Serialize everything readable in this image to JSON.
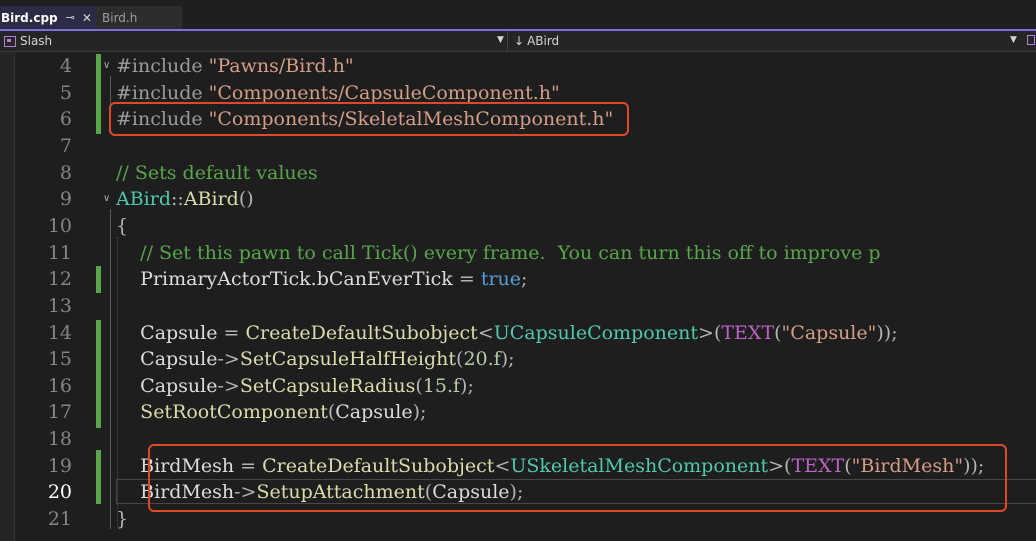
{
  "tabs": [
    {
      "label": "Bird.cpp",
      "pin": "⊸",
      "close": "✕"
    },
    {
      "label": "Bird.h"
    }
  ],
  "navbar": {
    "project": "Slash",
    "member_arrow": "↓",
    "member": "ABird"
  },
  "colors": {
    "accent": "#7c6fd9",
    "highlight": "#e0482a",
    "change_bar": "#57a64a"
  },
  "current_line": 20,
  "lines": [
    {
      "n": 4,
      "tokens": [
        [
          "pp",
          "#include "
        ],
        [
          "str",
          "\"Pawns/Bird.h\""
        ]
      ]
    },
    {
      "n": 5,
      "tokens": [
        [
          "pp",
          "#include "
        ],
        [
          "str",
          "\"Components/CapsuleComponent.h\""
        ]
      ]
    },
    {
      "n": 6,
      "tokens": [
        [
          "pp",
          "#include "
        ],
        [
          "str",
          "\"Components/SkeletalMeshComponent.h\""
        ]
      ]
    },
    {
      "n": 7,
      "tokens": []
    },
    {
      "n": 8,
      "tokens": [
        [
          "com",
          "// Sets default values"
        ]
      ]
    },
    {
      "n": 9,
      "tokens": [
        [
          "type",
          "ABird"
        ],
        [
          "punc",
          "::"
        ],
        [
          "fn",
          "ABird"
        ],
        [
          "punc",
          "()"
        ]
      ]
    },
    {
      "n": 10,
      "tokens": [
        [
          "punc",
          "{"
        ]
      ]
    },
    {
      "n": 11,
      "tokens": [
        [
          "var",
          "    "
        ],
        [
          "com",
          "// Set this pawn to call Tick() every frame.  You can turn this off to improve p"
        ]
      ]
    },
    {
      "n": 12,
      "tokens": [
        [
          "var",
          "    PrimaryActorTick.bCanEverTick "
        ],
        [
          "punc",
          "= "
        ],
        [
          "kw",
          "true"
        ],
        [
          "punc",
          ";"
        ]
      ]
    },
    {
      "n": 13,
      "tokens": []
    },
    {
      "n": 14,
      "tokens": [
        [
          "var",
          "    Capsule "
        ],
        [
          "punc",
          "= "
        ],
        [
          "fn",
          "CreateDefaultSubobject"
        ],
        [
          "punc",
          "<"
        ],
        [
          "type",
          "UCapsuleComponent"
        ],
        [
          "punc",
          ">("
        ],
        [
          "macro",
          "TEXT"
        ],
        [
          "punc",
          "("
        ],
        [
          "str",
          "\"Capsule\""
        ],
        [
          "punc",
          "));"
        ]
      ]
    },
    {
      "n": 15,
      "tokens": [
        [
          "var",
          "    Capsule"
        ],
        [
          "punc",
          "->"
        ],
        [
          "fn",
          "SetCapsuleHalfHeight"
        ],
        [
          "punc",
          "("
        ],
        [
          "num",
          "20.f"
        ],
        [
          "punc",
          ");"
        ]
      ]
    },
    {
      "n": 16,
      "tokens": [
        [
          "var",
          "    Capsule"
        ],
        [
          "punc",
          "->"
        ],
        [
          "fn",
          "SetCapsuleRadius"
        ],
        [
          "punc",
          "("
        ],
        [
          "num",
          "15.f"
        ],
        [
          "punc",
          ");"
        ]
      ]
    },
    {
      "n": 17,
      "tokens": [
        [
          "var",
          "    "
        ],
        [
          "fn",
          "SetRootComponent"
        ],
        [
          "punc",
          "("
        ],
        [
          "var",
          "Capsule"
        ],
        [
          "punc",
          ");"
        ]
      ]
    },
    {
      "n": 18,
      "tokens": []
    },
    {
      "n": 19,
      "tokens": [
        [
          "var",
          "    BirdMesh "
        ],
        [
          "punc",
          "= "
        ],
        [
          "fn",
          "CreateDefaultSubobject"
        ],
        [
          "punc",
          "<"
        ],
        [
          "type",
          "USkeletalMeshComponent"
        ],
        [
          "punc",
          ">("
        ],
        [
          "macro",
          "TEXT"
        ],
        [
          "punc",
          "("
        ],
        [
          "str",
          "\"BirdMesh\""
        ],
        [
          "punc",
          "));"
        ]
      ]
    },
    {
      "n": 20,
      "tokens": [
        [
          "var",
          "    BirdMesh"
        ],
        [
          "punc",
          "->"
        ],
        [
          "fn",
          "SetupAttachment"
        ],
        [
          "punc",
          "("
        ],
        [
          "var",
          "Capsule"
        ],
        [
          "punc",
          ");"
        ]
      ]
    },
    {
      "n": 21,
      "tokens": [
        [
          "punc",
          "}"
        ]
      ]
    }
  ]
}
